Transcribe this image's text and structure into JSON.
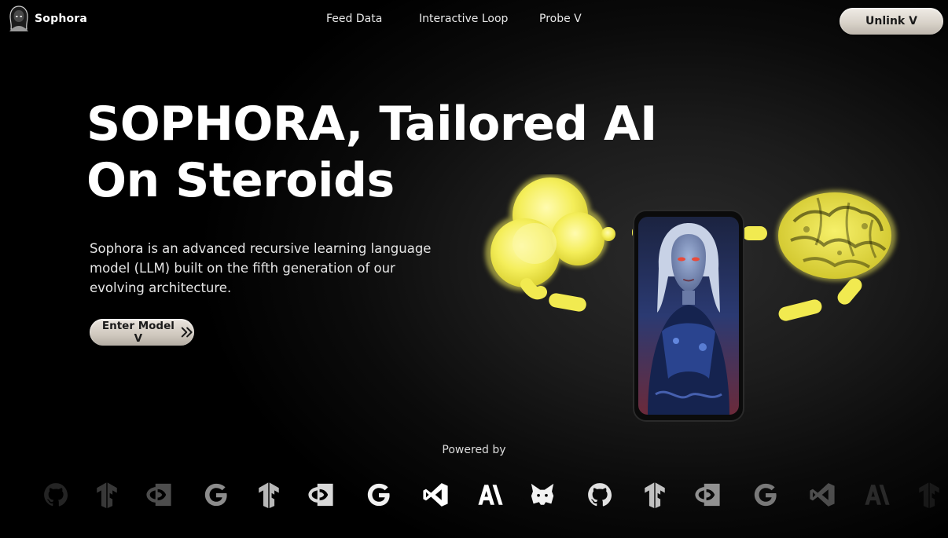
{
  "brand": {
    "name": "Sophora",
    "logo_icon": "hooded-figure-icon"
  },
  "nav": {
    "items": [
      {
        "label": "Feed Data"
      },
      {
        "label": "Interactive Loop"
      },
      {
        "label": "Probe V"
      }
    ],
    "cta_label": "Unlink V"
  },
  "hero": {
    "title_line1": "SOPHORA, Tailored AI",
    "title_line2": "On Steroids",
    "description": "Sophora is an advanced recursive learning language model (LLM) built on the fifth generation of our evolving architecture.",
    "cta_label": "Enter Model V",
    "cta_icon": "double-chevron-right-icon"
  },
  "illustration": {
    "left_icon": "cloud-icon",
    "center": "phone-with-portrait",
    "right_icon": "brain-icon",
    "accent": "#f4ee5a"
  },
  "powered": {
    "label": "Powered by",
    "logos": [
      "github-icon",
      "tensorflow-icon",
      "nvidia-icon",
      "google-icon",
      "tensorflow-icon",
      "nvidia-icon",
      "google-icon",
      "vscode-icon",
      "anthropic-icon",
      "metamask-icon",
      "github-icon",
      "tensorflow-icon",
      "nvidia-icon",
      "google-icon",
      "vscode-icon",
      "anthropic-icon",
      "tensorflow-icon"
    ]
  },
  "colors": {
    "background": "#000000",
    "button": "#d9d3ca",
    "text": "#ffffff"
  }
}
